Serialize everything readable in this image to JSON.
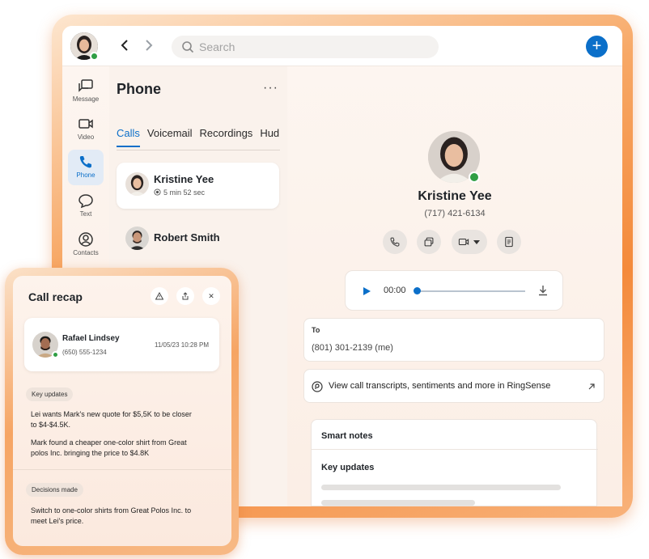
{
  "app": {
    "search_placeholder": "Search",
    "accent_color": "#0b6fc9",
    "online_status_color": "#2f9e44"
  },
  "topbar": {
    "back_icon": "chevron-left-icon",
    "forward_icon": "chevron-right-icon",
    "add_symbol": "+"
  },
  "rail": {
    "items": [
      {
        "label": "Message",
        "icon": "message-icon"
      },
      {
        "label": "Video",
        "icon": "video-icon"
      },
      {
        "label": "Phone",
        "icon": "phone-icon",
        "active": true
      },
      {
        "label": "Text",
        "icon": "text-bubble-icon"
      },
      {
        "label": "Contacts",
        "icon": "contacts-icon"
      }
    ]
  },
  "phone_panel": {
    "title": "Phone",
    "more_symbol": "···",
    "tabs": [
      "Calls",
      "Voicemail",
      "Recordings",
      "Hud"
    ],
    "active_tab": "Calls",
    "calls": [
      {
        "name": "Kristine Yee",
        "duration": "5 min 52 sec"
      },
      {
        "name": "Robert Smith"
      }
    ]
  },
  "detail": {
    "name": "Kristine Yee",
    "phone": "(717) 421-6134",
    "actions": [
      "phone-icon",
      "copy-icon",
      "video-icon",
      "notes-icon"
    ],
    "player": {
      "time": "00:00",
      "progress": 0
    },
    "to_label": "To",
    "to_value": "(801) 301-2139 (me)",
    "ringsense_text": "View call transcripts, sentiments and more in RingSense",
    "smart_notes": {
      "title": "Smart notes",
      "subtitle": "Key updates"
    }
  },
  "recap": {
    "title": "Call recap",
    "contact": {
      "name": "Rafael Lindsey",
      "phone": "(650) 555-1234",
      "date": "11/05/23 10:28 PM"
    },
    "sections": [
      {
        "label": "Key updates",
        "items": [
          "Lei wants Mark's new quote for $5,5K to be closer to $4-$4.5K.",
          "Mark found a cheaper one-color shirt from Great polos Inc. bringing the price to $4.8K"
        ]
      },
      {
        "label": "Decisions made",
        "items": [
          "Switch to one-color shirts from Great Polos Inc. to meet Lei's price."
        ]
      }
    ],
    "close_symbol": "✕"
  }
}
